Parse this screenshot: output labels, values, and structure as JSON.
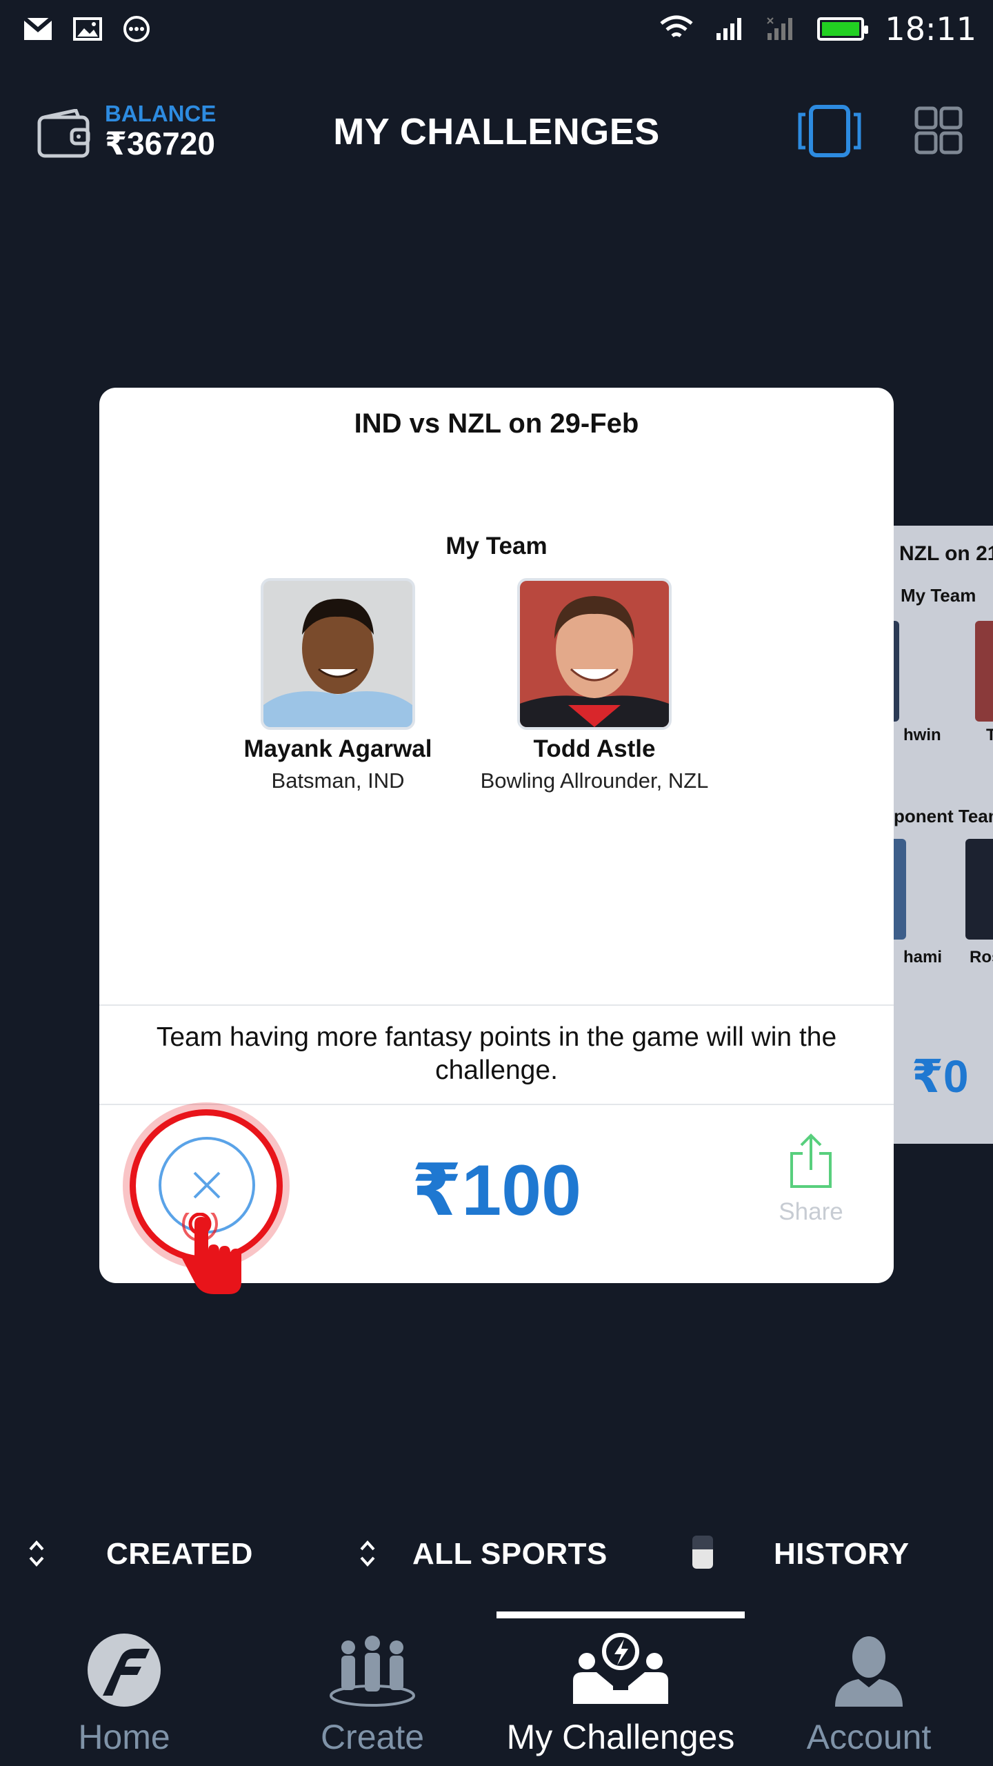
{
  "status_bar": {
    "time": "18:11",
    "notification_icons": [
      "gmail-icon",
      "image-icon",
      "more-icon"
    ],
    "system_icons": [
      "wifi-icon",
      "signal-icon",
      "signal-off-icon",
      "battery-icon"
    ],
    "battery_color": "#22d022"
  },
  "header": {
    "balance_label": "BALANCE",
    "balance_value": "₹36720",
    "title": "MY CHALLENGES",
    "accent": "#2d8be0"
  },
  "card": {
    "title": "IND vs NZL on 29-Feb",
    "team_label": "My Team",
    "players": [
      {
        "name": "Mayank Agarwal",
        "role": "Batsman, IND"
      },
      {
        "name": "Todd Astle",
        "role": "Bowling Allrounder, NZL"
      }
    ],
    "rule_text": "Team having more fantasy points in the game will win the challenge.",
    "amount": "₹100",
    "share_label": "Share",
    "amount_color": "#1f78d1"
  },
  "back_card": {
    "title": "NZL on 21",
    "team_label": "My Team",
    "players": [
      "hwin",
      "T"
    ],
    "opponent_label": "ponent Team",
    "opponents": [
      "hami",
      "Ros"
    ],
    "amount": "₹0"
  },
  "filters": {
    "created": "CREATED",
    "sports": "ALL SPORTS",
    "history": "HISTORY"
  },
  "nav": {
    "items": [
      {
        "label": "Home",
        "icon": "home-logo-icon"
      },
      {
        "label": "Create",
        "icon": "team-icon"
      },
      {
        "label": "My Challenges",
        "icon": "challenge-icon"
      },
      {
        "label": "Account",
        "icon": "user-icon"
      }
    ],
    "active_index": 2
  }
}
